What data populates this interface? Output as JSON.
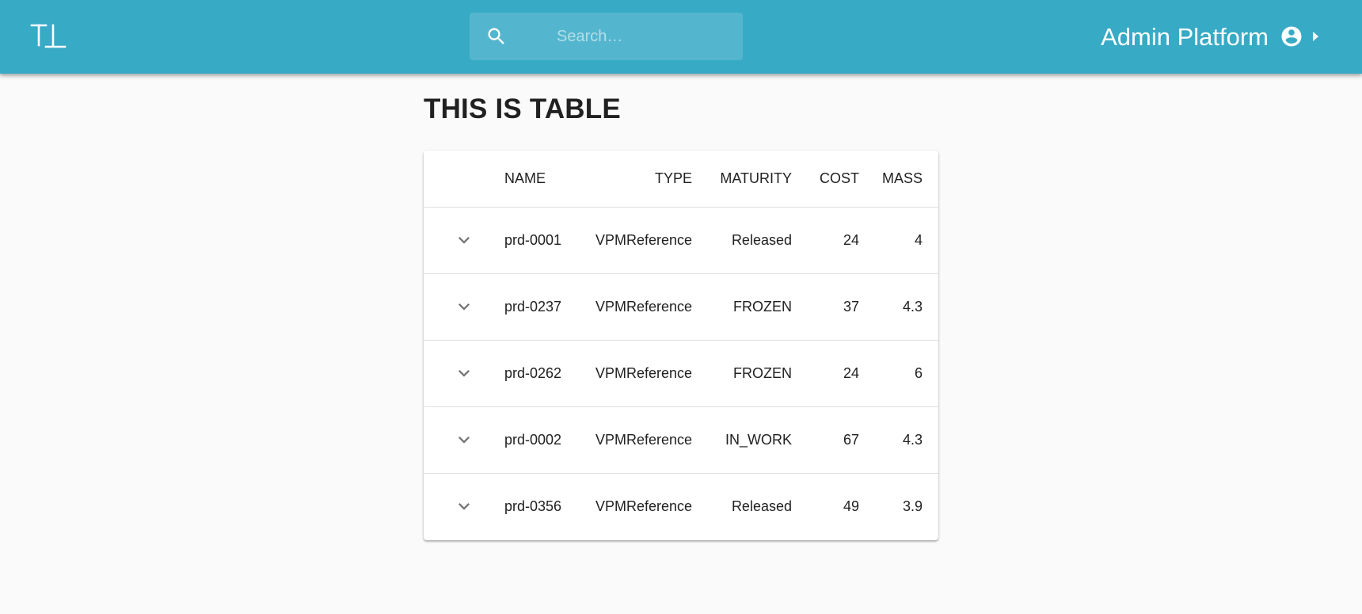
{
  "header": {
    "logo_text": "T⊥",
    "search": {
      "placeholder": "Search…",
      "value": "",
      "icon": "search-icon"
    },
    "platform_title": "Admin Platform",
    "account_icon": "account-circle-icon",
    "menu_arrow_icon": "arrow-right-icon",
    "bar_color": "#37aac6"
  },
  "main": {
    "title": "THIS IS TABLE",
    "table": {
      "columns": [
        "",
        "NAME",
        "TYPE",
        "MATURITY",
        "COST",
        "MASS"
      ],
      "expand_icon": "chevron-down-icon",
      "rows": [
        {
          "name": "prd-0001",
          "type": "VPMReference",
          "maturity": "Released",
          "cost": "24",
          "mass": "4"
        },
        {
          "name": "prd-0237",
          "type": "VPMReference",
          "maturity": "FROZEN",
          "cost": "37",
          "mass": "4.3"
        },
        {
          "name": "prd-0262",
          "type": "VPMReference",
          "maturity": "FROZEN",
          "cost": "24",
          "mass": "6"
        },
        {
          "name": "prd-0002",
          "type": "VPMReference",
          "maturity": "IN_WORK",
          "cost": "67",
          "mass": "4.3"
        },
        {
          "name": "prd-0356",
          "type": "VPMReference",
          "maturity": "Released",
          "cost": "49",
          "mass": "3.9"
        }
      ]
    }
  }
}
